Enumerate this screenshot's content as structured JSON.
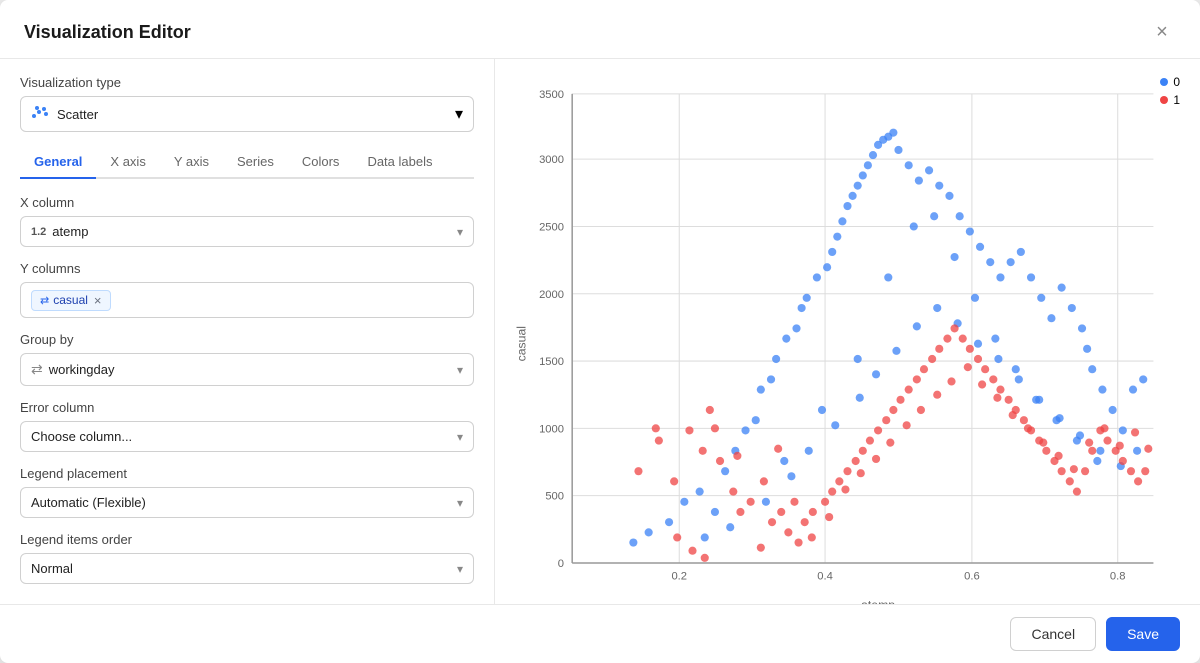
{
  "modal": {
    "title": "Visualization Editor",
    "close_label": "×"
  },
  "footer": {
    "cancel_label": "Cancel",
    "save_label": "Save"
  },
  "left": {
    "vis_type_label": "Visualization type",
    "vis_type_value": "Scatter",
    "tabs": [
      "General",
      "X axis",
      "Y axis",
      "Series",
      "Colors",
      "Data labels"
    ],
    "active_tab": "General",
    "x_column_label": "X column",
    "x_column_value": "atemp",
    "x_column_icon": "1.2",
    "y_columns_label": "Y columns",
    "y_columns_tags": [
      {
        "icon": "⇄",
        "label": "casual"
      }
    ],
    "group_by_label": "Group by",
    "group_by_value": "workingday",
    "group_by_icon": "⇄",
    "error_column_label": "Error column",
    "error_column_placeholder": "Choose column...",
    "legend_placement_label": "Legend placement",
    "legend_placement_value": "Automatic (Flexible)",
    "legend_items_order_label": "Legend items order",
    "legend_items_order_value": "Normal"
  },
  "chart": {
    "x_axis_label": "atemp",
    "y_axis_label": "casual",
    "x_ticks": [
      "0.2",
      "0.4",
      "0.6",
      "0.8"
    ],
    "y_ticks": [
      "0",
      "500",
      "1000",
      "1500",
      "2000",
      "2500",
      "3000",
      "3500"
    ],
    "legend": [
      {
        "label": "0",
        "color": "#3b82f6"
      },
      {
        "label": "1",
        "color": "#ef4444"
      }
    ]
  },
  "colors": {
    "accent": "#2563eb",
    "blue_dot": "#3b82f6",
    "red_dot": "#ef4444"
  }
}
